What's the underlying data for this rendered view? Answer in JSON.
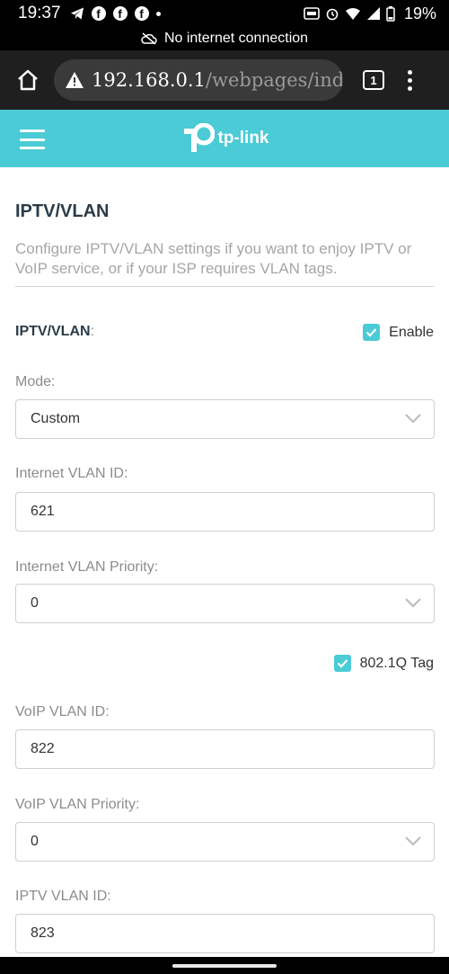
{
  "status": {
    "time": "19:37",
    "battery": "19%"
  },
  "network_banner": "No internet connection",
  "browser": {
    "url_host": "192.168.0.1",
    "url_path": "/webpages/inde",
    "tab_count": "1"
  },
  "header": {
    "brand": "tp-link"
  },
  "page": {
    "title": "IPTV/VLAN",
    "description": "Configure IPTV/VLAN settings if you want to enjoy IPTV or VoIP service, or if your ISP requires VLAN tags.",
    "iptv_label": "IPTV/VLAN",
    "iptv_colon": ":",
    "enable_label": "Enable",
    "enable_checked": true,
    "mode_label": "Mode:",
    "mode_value": "Custom",
    "internet_vlan_id_label": "Internet VLAN ID:",
    "internet_vlan_id_value": "621",
    "internet_vlan_priority_label": "Internet VLAN Priority:",
    "internet_vlan_priority_value": "0",
    "tag_label": "802.1Q Tag",
    "tag_checked": true,
    "voip_vlan_id_label": "VoIP VLAN ID:",
    "voip_vlan_id_value": "822",
    "voip_vlan_priority_label": "VoIP VLAN Priority:",
    "voip_vlan_priority_value": "0",
    "iptv_vlan_id_label": "IPTV VLAN ID:",
    "iptv_vlan_id_value": "823"
  },
  "colors": {
    "accent": "#4acbd6",
    "title": "#2b3c48"
  }
}
